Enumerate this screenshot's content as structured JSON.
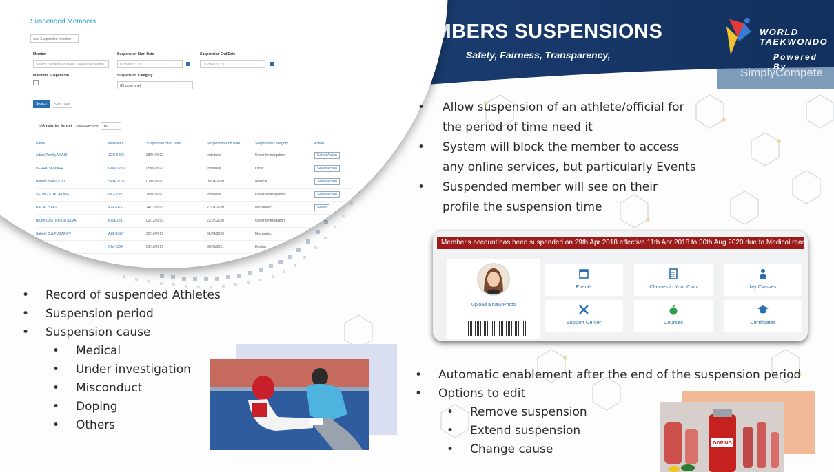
{
  "slide": {
    "title": "MEMBERS SUSPENSIONS",
    "subtitle": "Safety, Fairness, Transparency,",
    "logo": {
      "line1": "WORLD",
      "line2": "TAEKWONDO",
      "powered": "Powered By",
      "simply": "SimplyCompete"
    }
  },
  "screenshot": {
    "title": "Suspended Members",
    "add_button": "Add Suspended Member",
    "member_label": "Member",
    "member_placeholder": "Search by name or World Taekwondo Memb",
    "start_label": "Suspension Start Date",
    "start_placeholder": "DD/MM/YYYY",
    "end_label": "Suspension End Date",
    "end_placeholder": "DD/MM/YYYY",
    "indefinite_label": "Indefinite Suspension",
    "category_label": "Suspension Category",
    "category_value": "(Choose one)",
    "search_button": "Search",
    "clear_button": "Start Over",
    "results": "103 results found",
    "show_records": "Show Records",
    "records_value": "10",
    "columns": [
      "Name",
      "Member #",
      "Suspension Start Date",
      "Suspension End Date",
      "Suspension Category",
      "Action"
    ],
    "rows": [
      [
        "Adam Tawfiq AMARI",
        "JOR-6452",
        "28/04/2020",
        "Indefinite",
        "Under Investigation",
        "Select Action"
      ],
      [
        "DEREK SUMNER",
        "GBR-1779",
        "05/03/2020",
        "Indefinite",
        "Other",
        "Select Action"
      ],
      [
        "Bahrim HAMIDOVIC",
        "SRB-2715",
        "01/03/2020",
        "09/04/2020",
        "Medical",
        "Select Action"
      ],
      [
        "SEONG KUK JEONG",
        "ING-7080",
        "28/02/2020",
        "Indefinite",
        "Under Investigation",
        "Select Action"
      ],
      [
        "RADIK ISAEV",
        "AZE-1637",
        "24/12/2019",
        "21/01/2020",
        "Misconduct",
        "Select"
      ],
      [
        "Bruno CASTRO DA SILVA",
        "BRA-2691",
        "02/12/2019",
        "22/07/2020",
        "Under Investigation",
        ""
      ],
      [
        "Sabuhi ZULFUGAROV",
        "AZE-1567",
        "05/10/2019",
        "05/04/2020",
        "Misconduct",
        ""
      ],
      [
        "...",
        "CIV-1504",
        "01/10/2019",
        "30/08/2021",
        "Doping",
        ""
      ]
    ]
  },
  "left_bullets": [
    "Record of suspended Athletes",
    "Suspension period",
    "Suspension cause"
  ],
  "left_sub_bullets": [
    "Medical",
    "Under investigation",
    "Misconduct",
    "Doping",
    "Others"
  ],
  "right_bullets": [
    [
      "Allow suspension of an athlete/official for",
      "the period of time need it"
    ],
    [
      "System will block the member to access",
      "any online services, but particularly Events"
    ],
    [
      "Suspended member will see on their",
      "profile the suspension time"
    ]
  ],
  "profile": {
    "banner": "Member's account has been suspended on 29th Apr 2018 effective 11th Apr 2018 to 30th Aug 2020 due to Medical reasons.",
    "upload": "Upload a New Photo",
    "tiles": [
      {
        "label": "Events",
        "icon": "calendar-icon"
      },
      {
        "label": "Classes in Your Club",
        "icon": "clipboard-icon"
      },
      {
        "label": "My Classes",
        "icon": "person-icon"
      },
      {
        "label": "Support Center",
        "icon": "tools-icon"
      },
      {
        "label": "Courses",
        "icon": "apple-icon"
      },
      {
        "label": "Certificates",
        "icon": "graduation-cap-icon"
      }
    ],
    "accent": "#2a6fb0",
    "banner_color": "#9c1c1c"
  },
  "bottom_bullets": [
    "Automatic enablement after the end of the suspension period",
    "Options to edit"
  ],
  "bottom_sub_bullets": [
    "Remove suspension",
    "Extend suspension",
    "Change cause"
  ],
  "photo2_label": "DOPING"
}
